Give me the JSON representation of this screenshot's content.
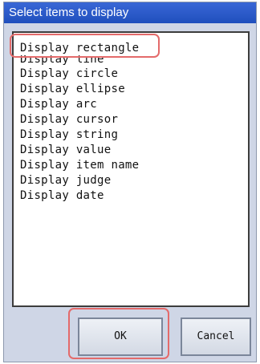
{
  "dialog": {
    "title": "Select items to display"
  },
  "list": {
    "selected_index": 0,
    "items": [
      {
        "label": "Display rectangle"
      },
      {
        "label": "Display line"
      },
      {
        "label": "Display circle"
      },
      {
        "label": "Display ellipse"
      },
      {
        "label": "Display arc"
      },
      {
        "label": "Display cursor"
      },
      {
        "label": "Display string"
      },
      {
        "label": "Display value"
      },
      {
        "label": "Display item name"
      },
      {
        "label": "Display judge"
      },
      {
        "label": "Display date"
      }
    ]
  },
  "buttons": {
    "ok_label": "OK",
    "cancel_label": "Cancel"
  },
  "colors": {
    "title_bar": "#2a58c8",
    "highlight": "#e46a6a",
    "dialog_bg": "#cfd6e6"
  }
}
